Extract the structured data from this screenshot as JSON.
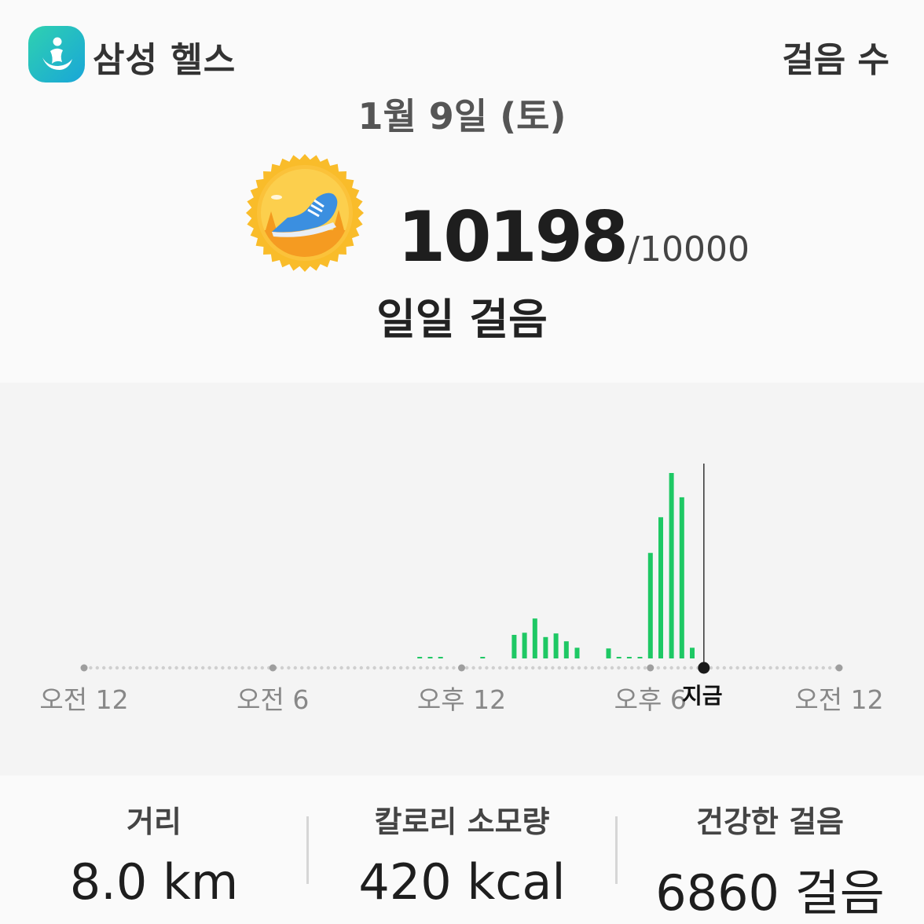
{
  "header": {
    "app_name": "삼성 헬스",
    "screen_title": "걸음 수",
    "app_icon": "samsung-health-runner-icon"
  },
  "date": "1월 9일 (토)",
  "summary": {
    "steps": "10198",
    "goal": "/10000",
    "label": "일일 걸음",
    "badge_icon": "running-shoe-badge-icon"
  },
  "chart": {
    "x_labels": [
      "오전 12",
      "오전 6",
      "오후 12",
      "오후 6",
      "오전 12"
    ],
    "now_label": "지금",
    "bar_color": "#1ec864"
  },
  "chart_data": {
    "type": "bar",
    "title": "",
    "xlabel": "",
    "ylabel": "",
    "x_unit": "hour of day",
    "xlim": [
      0,
      24
    ],
    "x_ticks": [
      0,
      6,
      12,
      18,
      24
    ],
    "x_tick_labels": [
      "오전 12",
      "오전 6",
      "오후 12",
      "오후 6",
      "오전 12"
    ],
    "now_hour": 19.7,
    "ylim": [
      0,
      1300
    ],
    "bar_interval_minutes": 20,
    "bars": [
      {
        "x": 10.67,
        "y": 5
      },
      {
        "x": 11.0,
        "y": 5
      },
      {
        "x": 11.33,
        "y": 5
      },
      {
        "x": 12.67,
        "y": 5
      },
      {
        "x": 13.67,
        "y": 165
      },
      {
        "x": 14.0,
        "y": 180
      },
      {
        "x": 14.33,
        "y": 280
      },
      {
        "x": 14.67,
        "y": 150
      },
      {
        "x": 15.0,
        "y": 175
      },
      {
        "x": 15.33,
        "y": 120
      },
      {
        "x": 15.67,
        "y": 75
      },
      {
        "x": 16.67,
        "y": 70
      },
      {
        "x": 17.0,
        "y": 5
      },
      {
        "x": 17.33,
        "y": 5
      },
      {
        "x": 17.67,
        "y": 5
      },
      {
        "x": 18.0,
        "y": 740
      },
      {
        "x": 18.33,
        "y": 990
      },
      {
        "x": 18.67,
        "y": 1300
      },
      {
        "x": 19.0,
        "y": 1130
      },
      {
        "x": 19.33,
        "y": 75
      }
    ]
  },
  "stats": [
    {
      "label": "거리",
      "value": "8.0 km"
    },
    {
      "label": "칼로리 소모량",
      "value": "420 kcal"
    },
    {
      "label": "건강한 걸음",
      "value": "6860 걸음"
    }
  ]
}
